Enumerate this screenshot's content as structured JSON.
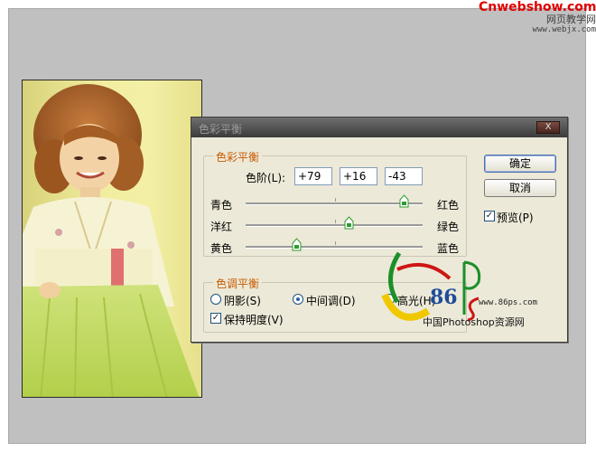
{
  "watermark_top": {
    "brand": "Cnwebshow.com",
    "cn": "网页教学网",
    "url": "www.webjx.com"
  },
  "dialog": {
    "title": "色彩平衡",
    "close_label": "X",
    "color_balance": {
      "legend": "色彩平衡",
      "levels_label": "色阶(L):",
      "levels": [
        "+79",
        "+16",
        "-43"
      ],
      "sliders": [
        {
          "left": "青色",
          "right": "红色",
          "value": 79
        },
        {
          "left": "洋红",
          "right": "绿色",
          "value": 16
        },
        {
          "left": "黄色",
          "right": "蓝色",
          "value": -43
        }
      ]
    },
    "tone_balance": {
      "legend": "色调平衡",
      "shadows": "阴影(S)",
      "midtones": "中间调(D)",
      "highlights": "高光(H)",
      "selected": "midtones",
      "preserve_luminosity": "保持明度(V)",
      "preserve_checked": true
    },
    "buttons": {
      "ok": "确定",
      "cancel": "取消"
    },
    "preview": {
      "label": "预览(P)",
      "checked": true
    }
  },
  "watermark_86ps": {
    "num": "86",
    "url": "www.86ps.com",
    "cn": "中国Photoshop资源网"
  },
  "icons": {
    "check": "✓",
    "slider_thumb": "slider-thumb-icon"
  },
  "colors": {
    "legend": "#c85a00",
    "track_thumb": "#2e9b2e",
    "canvas": "#c0c0c0"
  }
}
